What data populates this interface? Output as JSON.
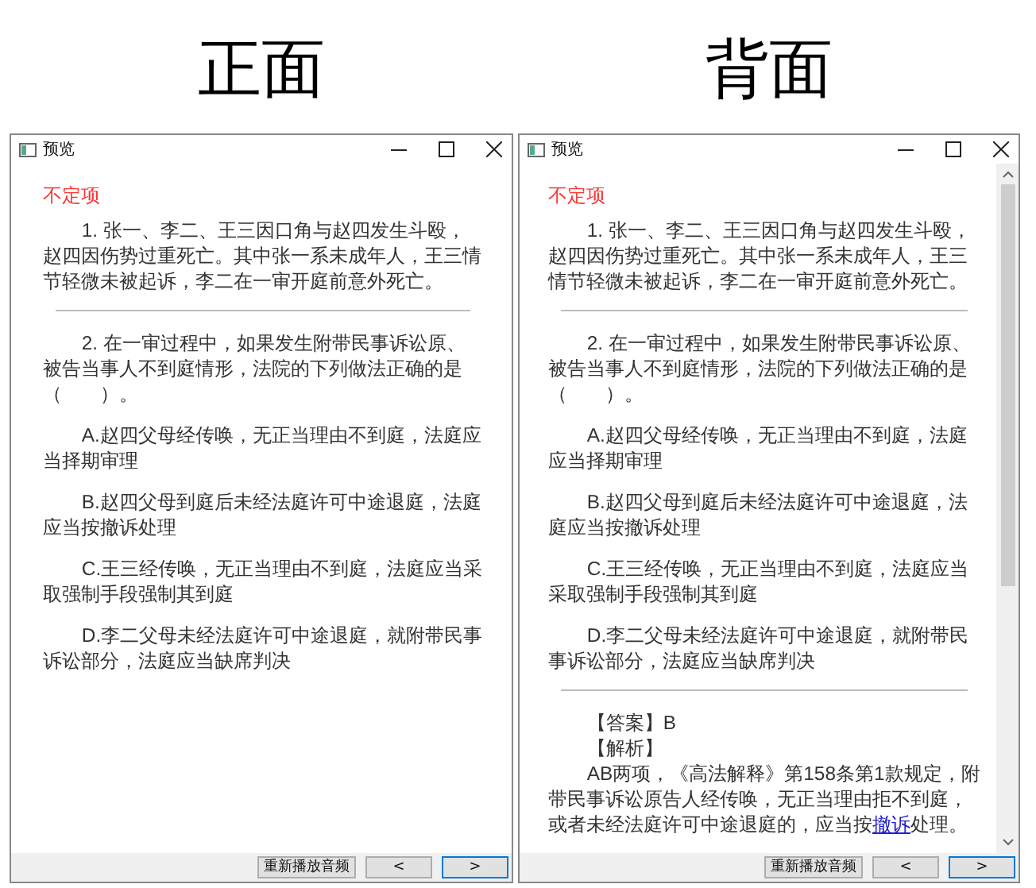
{
  "panels": [
    {
      "heading": "正面",
      "window": {
        "title": "预览",
        "scrollable": false
      },
      "blocks": [
        {
          "kind": "category",
          "text": "不定项"
        },
        {
          "kind": "paragraph",
          "text": "1. 张一、李二、王三因口角与赵四发生斗殴，赵四因伤势过重死亡。其中张一系未成年人，王三情节轻微未被起诉，李二在一审开庭前意外死亡。"
        },
        {
          "kind": "divider"
        },
        {
          "kind": "paragraph",
          "text": "2. 在一审过程中，如果发生附带民事诉讼原、被告当事人不到庭情形，法院的下列做法正确的是（　　）。"
        },
        {
          "kind": "paragraph",
          "text": "A.赵四父母经传唤，无正当理由不到庭，法庭应当择期审理"
        },
        {
          "kind": "paragraph",
          "text": "B.赵四父母到庭后未经法庭许可中途退庭，法庭应当按撤诉处理"
        },
        {
          "kind": "paragraph",
          "text": "C.王三经传唤，无正当理由不到庭，法庭应当采取强制手段强制其到庭"
        },
        {
          "kind": "paragraph",
          "text": "D.李二父母未经法庭许可中途退庭，就附带民事诉讼部分，法庭应当缺席判决"
        }
      ],
      "buttons": [
        {
          "label": "重新播放音频",
          "focused": false
        },
        {
          "label": "<",
          "focused": false
        },
        {
          "label": ">",
          "focused": true
        }
      ]
    },
    {
      "heading": "背面",
      "window": {
        "title": "预览",
        "scrollable": true
      },
      "blocks": [
        {
          "kind": "category",
          "text": "不定项"
        },
        {
          "kind": "paragraph",
          "text": "1. 张一、李二、王三因口角与赵四发生斗殴，赵四因伤势过重死亡。其中张一系未成年人，王三情节轻微未被起诉，李二在一审开庭前意外死亡。"
        },
        {
          "kind": "divider"
        },
        {
          "kind": "paragraph",
          "text": "2. 在一审过程中，如果发生附带民事诉讼原、被告当事人不到庭情形，法院的下列做法正确的是（　　）。"
        },
        {
          "kind": "paragraph",
          "text": "A.赵四父母经传唤，无正当理由不到庭，法庭应当择期审理"
        },
        {
          "kind": "paragraph",
          "text": "B.赵四父母到庭后未经法庭许可中途退庭，法庭应当按撤诉处理"
        },
        {
          "kind": "paragraph",
          "text": "C.王三经传唤，无正当理由不到庭，法庭应当采取强制手段强制其到庭"
        },
        {
          "kind": "paragraph",
          "text": "D.李二父母未经法庭许可中途退庭，就附带民事诉讼部分，法庭应当缺席判决"
        },
        {
          "kind": "divider"
        },
        {
          "kind": "note",
          "text": "【答案】B"
        },
        {
          "kind": "note",
          "text": "【解析】"
        },
        {
          "kind": "linked",
          "before": "AB两项，《高法解释》第158条第1款规定，附带民事诉讼原告人经传唤，无正当理由拒不到庭，或者未经法庭许可中途退庭的，应当按",
          "link": "撤诉",
          "after": "处理。"
        }
      ],
      "buttons": [
        {
          "label": "重新播放音频",
          "focused": false
        },
        {
          "label": "<",
          "focused": false
        },
        {
          "label": ">",
          "focused": true
        }
      ]
    }
  ]
}
